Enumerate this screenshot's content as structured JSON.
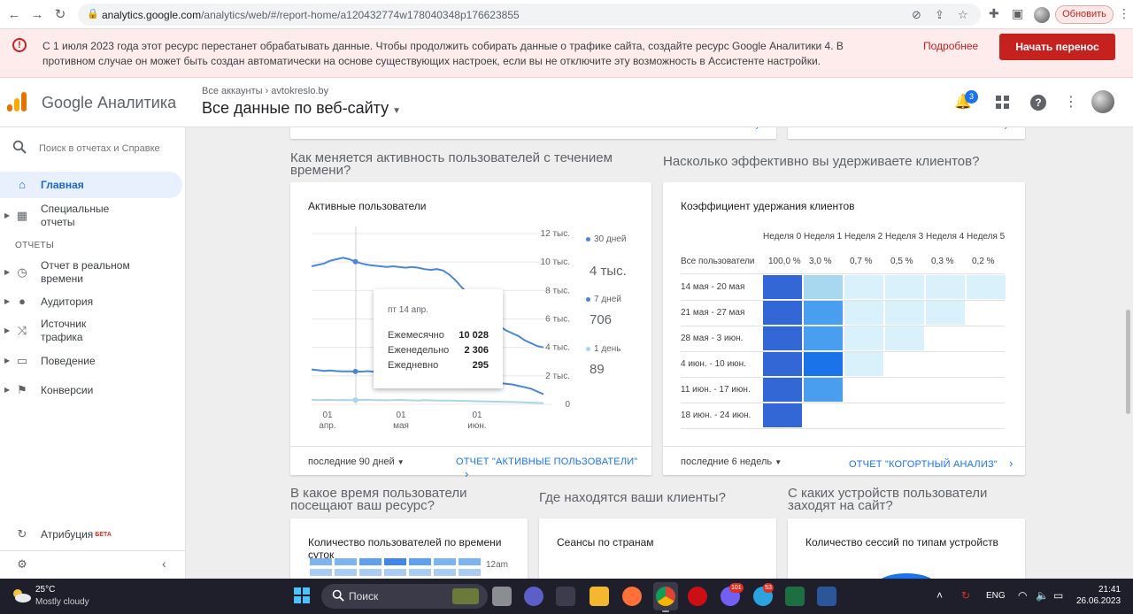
{
  "browser": {
    "url_domain": "analytics.google.com",
    "url_path": "/analytics/web/#/report-home/a120432774w178040348p176623855",
    "update_label": "Обновить"
  },
  "banner": {
    "text": "С 1 июля 2023 года этот ресурс перестанет обрабатывать данные. Чтобы продолжить собирать данные о трафике сайта, создайте ресурс Google Аналитики 4. В противном случае он может быть создан автоматически на основе существующих настроек, если вы не отключите эту возможность в Ассистенте настройки.",
    "more_link": "Подробнее",
    "migrate_button": "Начать перенос"
  },
  "header": {
    "product_name": "Google Аналитика",
    "breadcrumb_all": "Все аккаунты",
    "breadcrumb_site": "avtokreslo.by",
    "property": "Все данные по веб-сайту",
    "notifications_count": "3"
  },
  "sidebar": {
    "search_placeholder": "Поиск в отчетах и Справке",
    "home": "Главная",
    "custom_reports": "Специальные отчеты",
    "section_reports": "ОТЧЕТЫ",
    "realtime": "Отчет в реальном времени",
    "audience": "Аудитория",
    "acquisition": "Источник трафика",
    "behavior": "Поведение",
    "conversions": "Конверсии",
    "attribution": "Атрибуция",
    "beta": "БЕТА"
  },
  "sections": {
    "activity_question": "Как меняется активность пользователей с течением времени?",
    "retention_question": "Насколько эффективно вы удерживаете клиентов?",
    "time_question": "В какое время пользователи посещают ваш ресурс?",
    "location_question": "Где находятся ваши клиенты?",
    "devices_question": "С каких устройств пользователи заходят на сайт?"
  },
  "active_users": {
    "title": "Активные пользователи",
    "range": "последние 90 дней",
    "link": "ОТЧЕТ \"АКТИВНЫЕ ПОЛЬЗОВАТЕЛИ\"",
    "legend": [
      {
        "name": "30 дней",
        "value": "4 тыс.",
        "color": "#4a86d8"
      },
      {
        "name": "7 дней",
        "value": "706",
        "color": "#4a86d8"
      },
      {
        "name": "1 день",
        "value": "89",
        "color": "#a8d4ec"
      }
    ],
    "tooltip": {
      "date": "пт 14 апр.",
      "rows": [
        {
          "label": "Ежемесячно",
          "value": "10 028"
        },
        {
          "label": "Еженедельно",
          "value": "2 306"
        },
        {
          "label": "Ежедневно",
          "value": "295"
        }
      ]
    }
  },
  "chart_data": {
    "type": "line",
    "y_ticks": [
      "12 тыс.",
      "10 тыс.",
      "8 тыс.",
      "6 тыс.",
      "4 тыс.",
      "2 тыс.",
      "0"
    ],
    "x_ticks": [
      {
        "day": "01",
        "month": "апр."
      },
      {
        "day": "01",
        "month": "мая"
      },
      {
        "day": "01",
        "month": "июн."
      }
    ],
    "ylim": [
      0,
      12000
    ],
    "series": [
      {
        "name": "30 дней",
        "color": "#4a86d8",
        "values": [
          9700,
          9800,
          9900,
          10100,
          10200,
          10300,
          10200,
          10028,
          9900,
          9800,
          9750,
          9700,
          9650,
          9700,
          9650,
          9600,
          9650,
          9600,
          9500,
          9450,
          9500,
          9400,
          9100,
          8700,
          8200,
          7800,
          7200,
          6700,
          6300,
          5900,
          5500,
          5200,
          5000,
          4800,
          4500,
          4300,
          4100,
          4000
        ]
      },
      {
        "name": "7 дней",
        "color": "#4a86d8",
        "values": [
          2450,
          2400,
          2350,
          2380,
          2330,
          2320,
          2310,
          2306,
          2300,
          2330,
          2280,
          2260,
          2250,
          2240,
          2260,
          2230,
          2200,
          2180,
          2150,
          2100,
          2050,
          2000,
          1950,
          1850,
          1800,
          1750,
          1700,
          1650,
          1600,
          1550,
          1500,
          1450,
          1400,
          1300,
          1200,
          1100,
          900,
          706
        ]
      },
      {
        "name": "1 день",
        "color": "#a8d4ec",
        "values": [
          330,
          300,
          310,
          320,
          290,
          305,
          300,
          295,
          310,
          330,
          300,
          290,
          285,
          300,
          310,
          290,
          280,
          270,
          290,
          280,
          270,
          260,
          270,
          250,
          240,
          230,
          220,
          210,
          200,
          190,
          180,
          170,
          160,
          150,
          130,
          120,
          100,
          89
        ]
      }
    ]
  },
  "retention": {
    "title": "Коэффициент удержания клиентов",
    "range": "последние 6 недель",
    "link": "ОТЧЕТ \"КОГОРТНЫЙ АНАЛИЗ\"",
    "weeks": [
      "Неделя 0",
      "Неделя 1",
      "Неделя 2",
      "Неделя 3",
      "Неделя 4",
      "Неделя 5"
    ],
    "all_users_label": "Все пользователи",
    "all_users_values": [
      "100,0 %",
      "3,0 %",
      "0,7 %",
      "0,5 %",
      "0,3 %",
      "0,2 %"
    ],
    "rows": [
      {
        "label": "14 мая - 20 мая",
        "levels": [
          1.0,
          0.45,
          0.18,
          0.18,
          0.18,
          0.18
        ]
      },
      {
        "label": "21 мая - 27 мая",
        "levels": [
          1.0,
          0.7,
          0.18,
          0.18,
          0.18
        ]
      },
      {
        "label": "28 мая - 3 июн.",
        "levels": [
          1.0,
          0.7,
          0.18,
          0.18
        ]
      },
      {
        "label": "4 июн. - 10 июн.",
        "levels": [
          1.0,
          0.95,
          0.18
        ]
      },
      {
        "label": "11 июн. - 17 июн.",
        "levels": [
          1.0,
          0.7
        ]
      },
      {
        "label": "18 июн. - 24 июн.",
        "levels": [
          1.0
        ]
      }
    ]
  },
  "bottom_cards": {
    "time_title": "Количество пользователей по времени суток",
    "time_label": "12am",
    "countries_title": "Сеансы по странам",
    "devices_title": "Количество сессий по типам устройств"
  },
  "taskbar": {
    "temperature": "25°C",
    "weather": "Mostly cloudy",
    "search": "Поиск",
    "lang": "ENG",
    "time": "21:41",
    "date": "26.06.2023",
    "viber_badge": "101",
    "telegram_badge": "53"
  }
}
